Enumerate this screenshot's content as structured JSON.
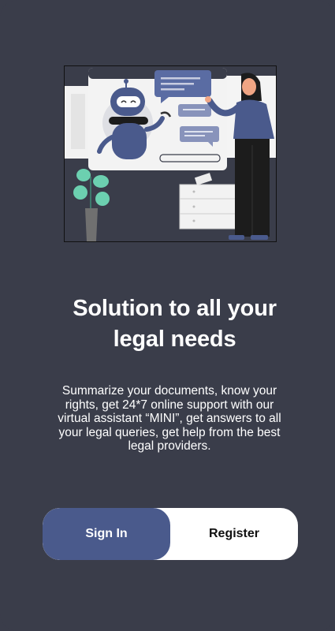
{
  "hero": {
    "illustration": "robot-assistant-and-woman-presenting-illustration",
    "title_line1": "Solution to all your",
    "title_line2": "legal needs"
  },
  "description": {
    "line1": "Summarize your documents, know your",
    "line2": "rights, get 24*7 online support with our",
    "line3": "virtual assistant “MINI”, get answers to all",
    "line4": "your legal queries, get help from the best",
    "line5": "legal providers."
  },
  "auth": {
    "signin_label": "Sign In",
    "register_label": "Register",
    "selected": "signin"
  },
  "colors": {
    "background": "#3a3d4a",
    "accent": "#4a5a8c",
    "button_bg": "#ffffff",
    "text": "#ffffff"
  }
}
